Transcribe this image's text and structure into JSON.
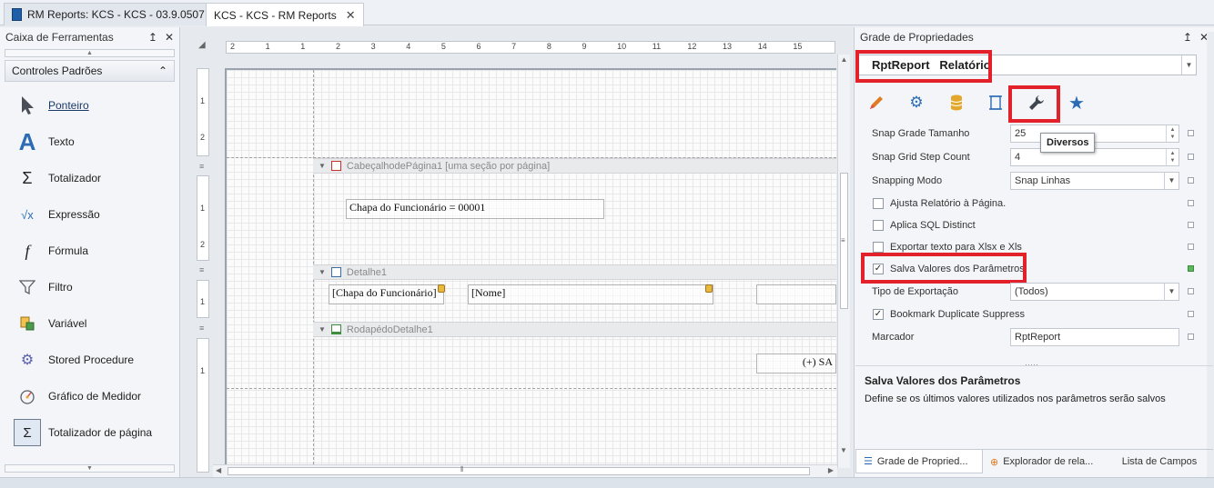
{
  "tabs": [
    {
      "label": "RM Reports: KCS - KCS - 03.9.0507"
    },
    {
      "label": "KCS - KCS - RM Reports"
    }
  ],
  "toolbox": {
    "title": "Caixa de Ferramentas",
    "pin": "↥",
    "close": "✕",
    "group": "Controles Padrões",
    "items": [
      {
        "label": "Ponteiro",
        "icon": "pointer-icon"
      },
      {
        "label": "Texto",
        "icon": "text-icon"
      },
      {
        "label": "Totalizador",
        "icon": "sum-icon"
      },
      {
        "label": "Expressão",
        "icon": "expression-icon"
      },
      {
        "label": "Fórmula",
        "icon": "formula-icon"
      },
      {
        "label": "Filtro",
        "icon": "filter-icon"
      },
      {
        "label": "Variável",
        "icon": "variable-icon"
      },
      {
        "label": "Stored Procedure",
        "icon": "stored-procedure-icon"
      },
      {
        "label": "Gráfico de Medidor",
        "icon": "gauge-icon"
      },
      {
        "label": "Totalizador de página",
        "icon": "page-sum-icon"
      }
    ]
  },
  "designer": {
    "ruler_labels": [
      "2",
      "1",
      "1",
      "2",
      "3",
      "4",
      "5",
      "6",
      "7",
      "8",
      "9",
      "10",
      "11",
      "12",
      "13",
      "14",
      "15"
    ],
    "v_ruler_labels": [
      "1",
      "2",
      "1",
      "2",
      "1",
      "1"
    ],
    "bands": [
      {
        "label": "CabeçalhodePágina1 [uma seção por página]"
      },
      {
        "label": "Detalhe1"
      },
      {
        "label": "RodapédoDetalhe1"
      }
    ],
    "fields": {
      "header_field": "Chapa do Funcionário = 00001",
      "detail_chapa": "[Chapa do Funcionário]",
      "detail_nome": "[Nome]",
      "footer_field": "(+) SA"
    }
  },
  "properties": {
    "title": "Grade de Propriedades",
    "object": "RptReport   Relatório",
    "tooltip": "Diversos",
    "rows": [
      {
        "name": "Snap Grade Tamanho",
        "value": "25"
      },
      {
        "name": "Snap Grid Step Count",
        "value": "4"
      },
      {
        "name": "Snapping Modo",
        "value": "Snap Linhas"
      },
      {
        "name": "Ajusta Relatório à Página."
      },
      {
        "name": "Aplica SQL Distinct"
      },
      {
        "name": "Exportar texto para Xlsx e Xls"
      },
      {
        "name": "Salva Valores dos Parâmetros"
      },
      {
        "name": "Tipo de Exportação",
        "value": "(Todos)"
      },
      {
        "name": "Bookmark Duplicate Suppress"
      },
      {
        "name": "Marcador",
        "value": "RptReport"
      }
    ],
    "description_title": "Salva Valores dos Parâmetros",
    "description_text": "Define se os últimos valores utilizados nos parâmetros serão salvos",
    "bottom_tabs": [
      "Grade de Propried...",
      "Explorador de rela...",
      "Lista de Campos"
    ],
    "checked": [
      "Salva Valores dos Parâmetros",
      "Bookmark Duplicate Suppress"
    ]
  },
  "colors": {
    "highlight": "#e2212b",
    "accent": "#1f5fa8"
  }
}
